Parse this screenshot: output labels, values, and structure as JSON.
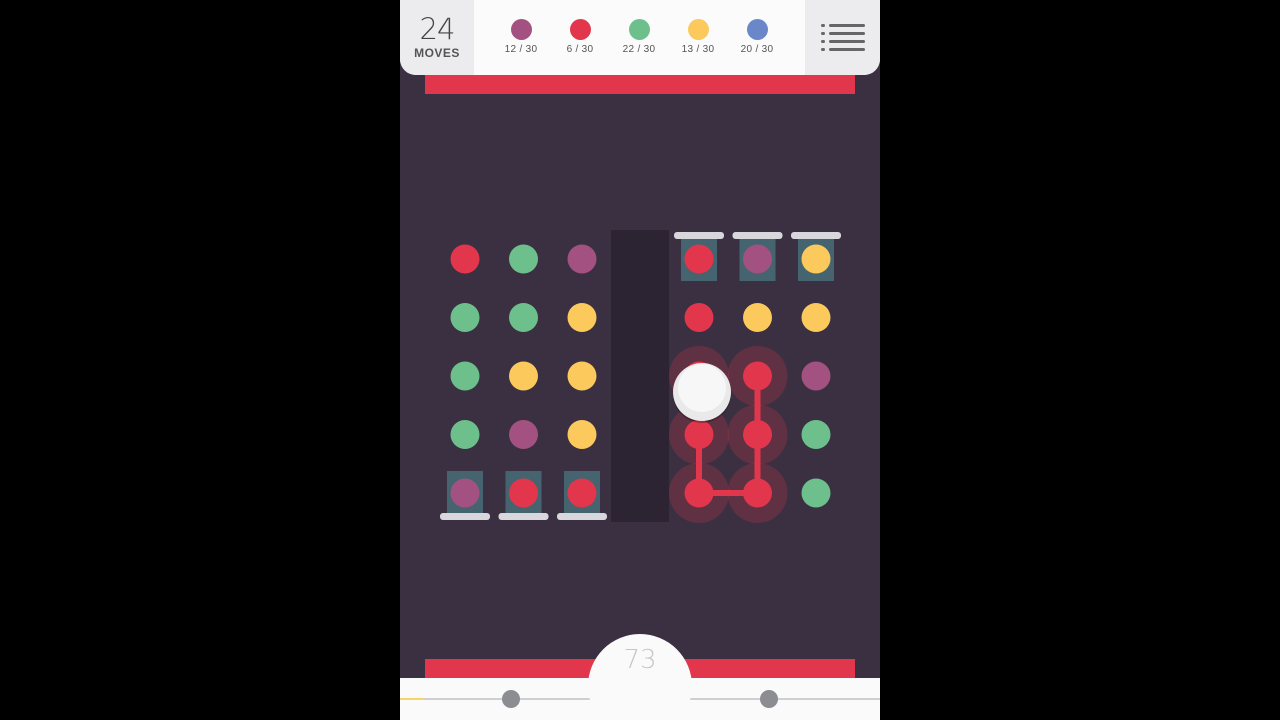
{
  "header": {
    "moves": {
      "count": "24",
      "label": "MOVES"
    },
    "goals": [
      {
        "color_name": "purple",
        "color": "#a25181",
        "progress": "12 / 30"
      },
      {
        "color_name": "red",
        "color": "#e2364c",
        "progress": "6 / 30"
      },
      {
        "color_name": "green",
        "color": "#6dc08b",
        "progress": "22 / 30"
      },
      {
        "color_name": "yellow",
        "color": "#fbc95c",
        "progress": "13 / 30"
      },
      {
        "color_name": "blue",
        "color": "#6a87c9",
        "progress": "20 / 30"
      }
    ],
    "menu_icon": "list-menu-icon"
  },
  "colors": {
    "background": "#3a3041",
    "purple": "#a25181",
    "red": "#e2364c",
    "green": "#6dc08b",
    "yellow": "#fbc95c",
    "blue": "#6a87c9",
    "bar": "#e2364c"
  },
  "board": {
    "rows": 5,
    "cols": 7,
    "grid": [
      [
        "red",
        "green",
        "purple",
        "empty",
        "red",
        "purple",
        "yellow"
      ],
      [
        "green",
        "green",
        "yellow",
        "empty",
        "red",
        "yellow",
        "yellow"
      ],
      [
        "green",
        "yellow",
        "yellow",
        "empty",
        "red",
        "red",
        "purple"
      ],
      [
        "green",
        "purple",
        "yellow",
        "empty",
        "red",
        "red",
        "green"
      ],
      [
        "purple",
        "red",
        "red",
        "empty",
        "red",
        "red",
        "green"
      ]
    ],
    "ice_cells": [
      [
        0,
        4
      ],
      [
        0,
        5
      ],
      [
        0,
        6
      ],
      [
        4,
        0
      ],
      [
        4,
        1
      ],
      [
        4,
        2
      ]
    ],
    "connection_path": [
      [
        2,
        5
      ],
      [
        3,
        5
      ],
      [
        4,
        5
      ],
      [
        4,
        4
      ],
      [
        3,
        4
      ],
      [
        2,
        4
      ]
    ],
    "finger_cursor_cell": [
      2,
      4
    ]
  },
  "footer": {
    "score": "73",
    "level_progress": 0.1,
    "milestones": 3
  }
}
